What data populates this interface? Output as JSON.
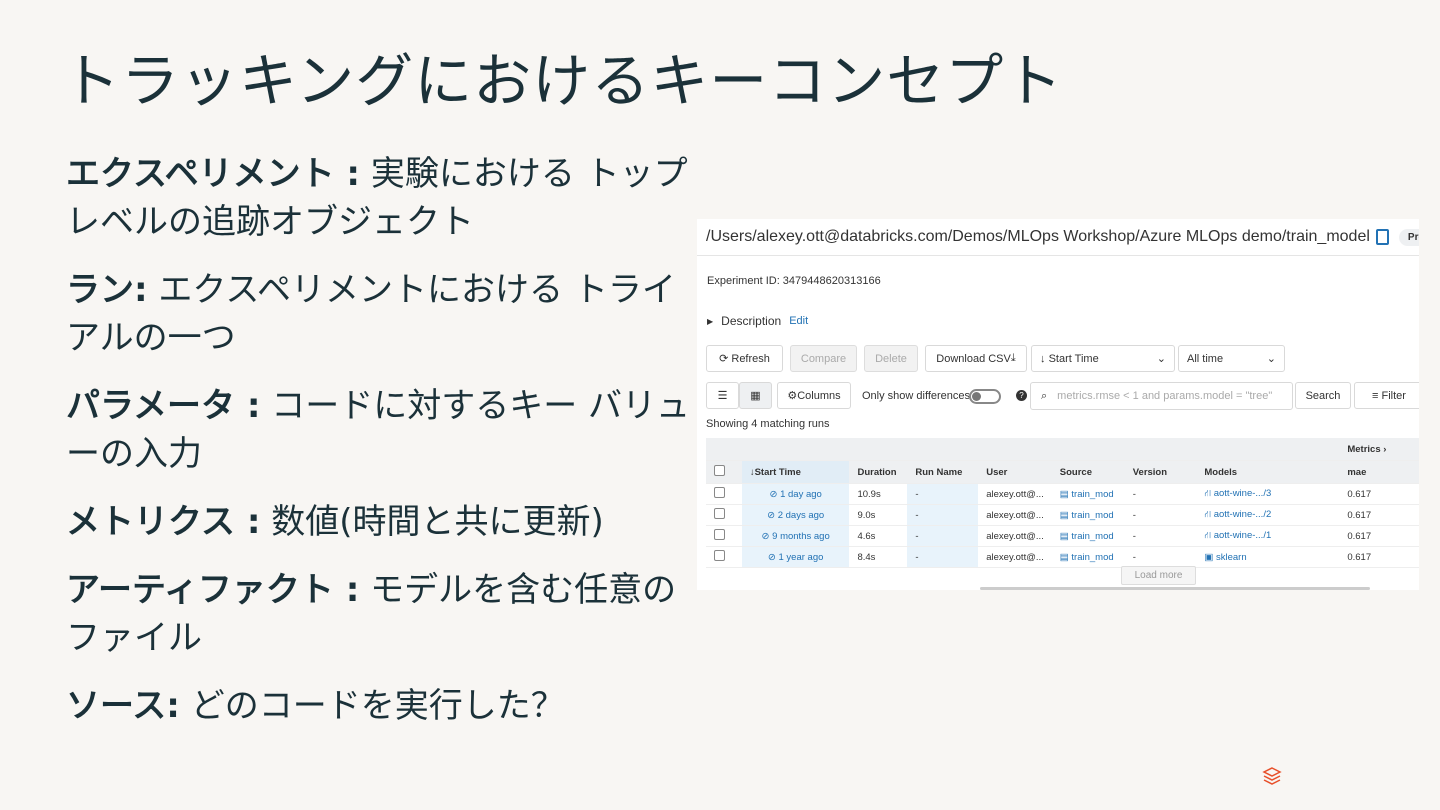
{
  "title": "トラッキングにおけるキーコンセプト",
  "concepts": [
    {
      "term": "エクスペリメント :",
      "desc": "実験における トップレベルの追跡オブジェクト"
    },
    {
      "term": "ラン:",
      "desc": "エクスペリメントにおける トライアルの一つ"
    },
    {
      "term": "パラメータ :",
      "desc": "コードに対するキー バリューの入力"
    },
    {
      "term": "メトリクス :",
      "desc": "数値(時間と共に更新)"
    },
    {
      "term": "アーティファクト :",
      "desc": "モデルを含む任意のファイル"
    },
    {
      "term": "ソース:",
      "desc": "どのコードを実行した？"
    }
  ],
  "screenshot": {
    "path": "/Users/alexey.ott@databricks.com/Demos/MLOps Workshop/Azure MLOps demo/train_model",
    "preview": "Preview",
    "experiment_id": "Experiment ID:  3479448620313166",
    "description": "Description",
    "edit": "Edit",
    "buttons": {
      "refresh": "Refresh",
      "compare": "Compare",
      "delete": "Delete",
      "download": "Download CSV",
      "start_time": "Start Time",
      "all_time": "All time",
      "columns": "Columns",
      "search": "Search",
      "filter": "Filter",
      "load_more": "Load more"
    },
    "only_show_differences": "Only show differences",
    "search_placeholder": "metrics.rmse < 1 and params.model = \"tree\"",
    "matching": "Showing 4 matching runs",
    "metrics_group": "Metrics",
    "columns": [
      "Start Time",
      "Duration",
      "Run Name",
      "User",
      "Source",
      "Version",
      "Models",
      "mae"
    ],
    "rows": [
      {
        "start": "1 day ago",
        "duration": "10.9s",
        "run_name": "-",
        "user": "alexey.ott@...",
        "source": "train_mod",
        "version": "-",
        "model": "aott-wine-.../3",
        "mae": "0.617"
      },
      {
        "start": "2 days ago",
        "duration": "9.0s",
        "run_name": "-",
        "user": "alexey.ott@...",
        "source": "train_mod",
        "version": "-",
        "model": "aott-wine-.../2",
        "mae": "0.617"
      },
      {
        "start": "9 months ago",
        "duration": "4.6s",
        "run_name": "-",
        "user": "alexey.ott@...",
        "source": "train_mod",
        "version": "-",
        "model": "aott-wine-.../1",
        "mae": "0.617"
      },
      {
        "start": "1 year ago",
        "duration": "8.4s",
        "run_name": "-",
        "user": "alexey.ott@...",
        "source": "train_mod",
        "version": "-",
        "model": "sklearn",
        "mae": "0.617"
      }
    ]
  }
}
